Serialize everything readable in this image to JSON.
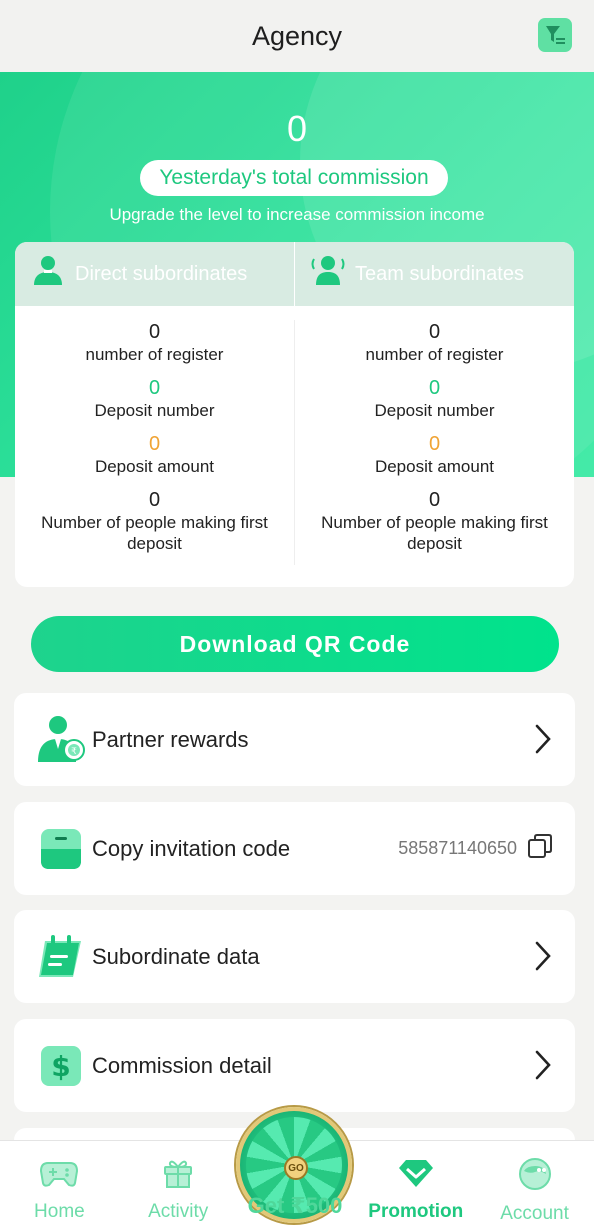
{
  "header": {
    "title": "Agency",
    "filter_icon": "filter-icon"
  },
  "banner": {
    "yesterday_value": "0",
    "yesterday_label": "Yesterday's total commission",
    "upgrade_text": "Upgrade the level to increase commission income"
  },
  "stats": {
    "direct": {
      "title": "Direct subordinates",
      "register_value": "0",
      "register_label": "number of register",
      "deposit_num_value": "0",
      "deposit_num_label": "Deposit number",
      "deposit_amt_value": "0",
      "deposit_amt_label": "Deposit amount",
      "first_deposit_value": "0",
      "first_deposit_label": "Number of people making first deposit"
    },
    "team": {
      "title": "Team subordinates",
      "register_value": "0",
      "register_label": "number of register",
      "deposit_num_value": "0",
      "deposit_num_label": "Deposit number",
      "deposit_amt_value": "0",
      "deposit_amt_label": "Deposit amount",
      "first_deposit_value": "0",
      "first_deposit_label": "Number of people making first deposit"
    }
  },
  "qr_button": "Download QR Code",
  "menu": {
    "partner": "Partner rewards",
    "invite": "Copy invitation code",
    "invite_code": "585871140650",
    "subordinate": "Subordinate data",
    "commission": "Commission detail"
  },
  "tabbar": {
    "home": "Home",
    "activity": "Activity",
    "center": "Get ₹500",
    "wheel_text": "GO",
    "promotion": "Promotion",
    "account": "Account"
  },
  "colors": {
    "accent": "#1ec87f",
    "orange": "#f0a435",
    "header_bg": "#f2f2f0"
  }
}
